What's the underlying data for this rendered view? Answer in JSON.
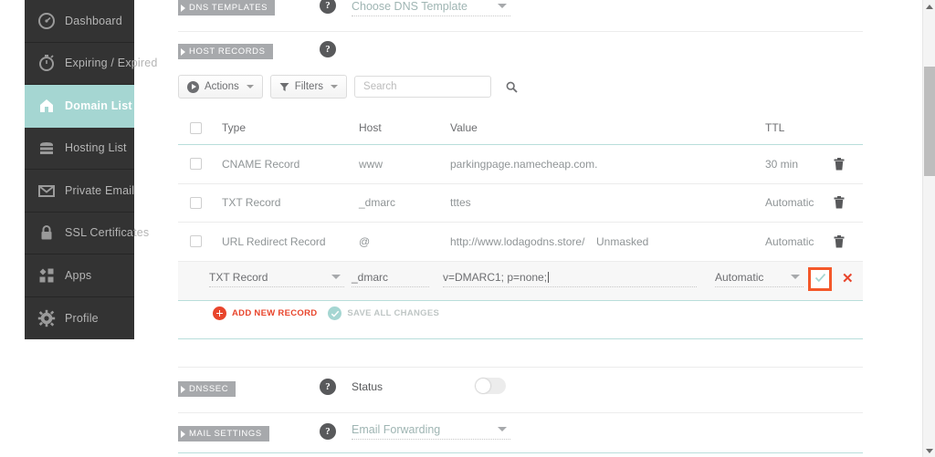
{
  "sidebar": {
    "items": [
      {
        "label": "Dashboard",
        "icon": "gauge-icon",
        "active": false
      },
      {
        "label": "Expiring / Expired",
        "icon": "stopwatch-icon",
        "active": false
      },
      {
        "label": "Domain List",
        "icon": "home-icon",
        "active": true
      },
      {
        "label": "Hosting List",
        "icon": "server-icon",
        "active": false
      },
      {
        "label": "Private Email",
        "icon": "envelope-icon",
        "active": false
      },
      {
        "label": "SSL Certificates",
        "icon": "lock-icon",
        "active": false
      },
      {
        "label": "Apps",
        "icon": "grid-icon",
        "active": false
      },
      {
        "label": "Profile",
        "icon": "gear-icon",
        "active": false
      }
    ]
  },
  "dns_templates": {
    "tag": "DNS TEMPLATES",
    "help": "?",
    "select_value": "Choose DNS Template"
  },
  "host_records": {
    "tag": "HOST RECORDS",
    "help": "?",
    "toolbar": {
      "actions_label": "Actions",
      "filters_label": "Filters",
      "search_placeholder": "Search",
      "search_value": ""
    },
    "columns": [
      "Type",
      "Host",
      "Value",
      "TTL"
    ],
    "rows": [
      {
        "type": "CNAME Record",
        "host": "www",
        "value": "parkingpage.namecheap.com.",
        "extra": "",
        "ttl": "30 min"
      },
      {
        "type": "TXT Record",
        "host": "_dmarc",
        "value": "tttes",
        "extra": "",
        "ttl": "Automatic"
      },
      {
        "type": "URL Redirect Record",
        "host": "@",
        "value": "http://www.lodagodns.store/",
        "extra": "Unmasked",
        "ttl": "Automatic"
      }
    ],
    "edit_row": {
      "type_value": "TXT Record",
      "host_value": "_dmarc",
      "value_value": "v=DMARC1; p=none;",
      "ttl_value": "Automatic",
      "confirm_icon": "check-icon",
      "cancel_icon": "close-icon"
    },
    "add_record_label": "ADD NEW RECORD",
    "save_changes_label": "SAVE ALL CHANGES"
  },
  "dnssec": {
    "tag": "DNSSEC",
    "help": "?",
    "status_label": "Status",
    "toggle_state": "off"
  },
  "mail_settings": {
    "tag": "MAIL SETTINGS",
    "help": "?",
    "select_value": "Email Forwarding"
  },
  "colors": {
    "accent_teal": "#a5d6d2",
    "sidebar_dark": "#333333",
    "highlight_orange": "#f4582a",
    "danger_red": "#e8452c"
  }
}
